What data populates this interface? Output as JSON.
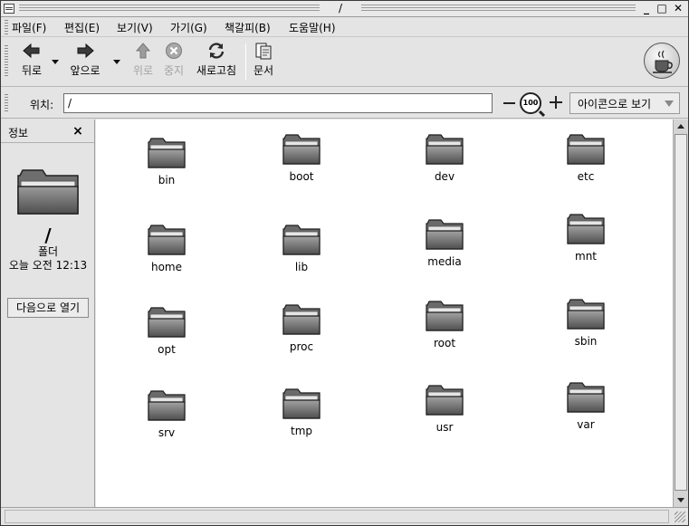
{
  "window": {
    "title": "/",
    "minimize": "_",
    "maximize": "□",
    "close": "✕"
  },
  "menubar": {
    "items": [
      {
        "label": "파일(F)"
      },
      {
        "label": "편집(E)"
      },
      {
        "label": "보기(V)"
      },
      {
        "label": "가기(G)"
      },
      {
        "label": "책갈피(B)"
      },
      {
        "label": "도움말(H)"
      }
    ]
  },
  "toolbar": {
    "back_label": "뒤로",
    "forward_label": "앞으로",
    "up_label": "위로",
    "stop_label": "중지",
    "reload_label": "새로고침",
    "documents_label": "문서"
  },
  "location": {
    "label": "위치:",
    "value": "/",
    "zoom_level": "100",
    "view_mode": "아이콘으로 보기"
  },
  "sidepane": {
    "title": "정보",
    "close": "×",
    "folder_name": "/",
    "folder_type": "폴더",
    "modified": "오늘 오전 12:13",
    "open_with_button": "다음으로 열기"
  },
  "files": [
    {
      "name": "bin"
    },
    {
      "name": "boot"
    },
    {
      "name": "dev"
    },
    {
      "name": "etc"
    },
    {
      "name": "home"
    },
    {
      "name": "lib"
    },
    {
      "name": "media"
    },
    {
      "name": "mnt"
    },
    {
      "name": "opt"
    },
    {
      "name": "proc"
    },
    {
      "name": "root"
    },
    {
      "name": "sbin"
    },
    {
      "name": "srv"
    },
    {
      "name": "tmp"
    },
    {
      "name": "usr"
    },
    {
      "name": "var"
    }
  ],
  "icons": {
    "folder": "folder-icon",
    "back": "arrow-left-icon",
    "forward": "arrow-right-icon",
    "up": "arrow-up-icon",
    "stop": "stop-icon",
    "reload": "reload-icon",
    "documents": "documents-icon"
  }
}
